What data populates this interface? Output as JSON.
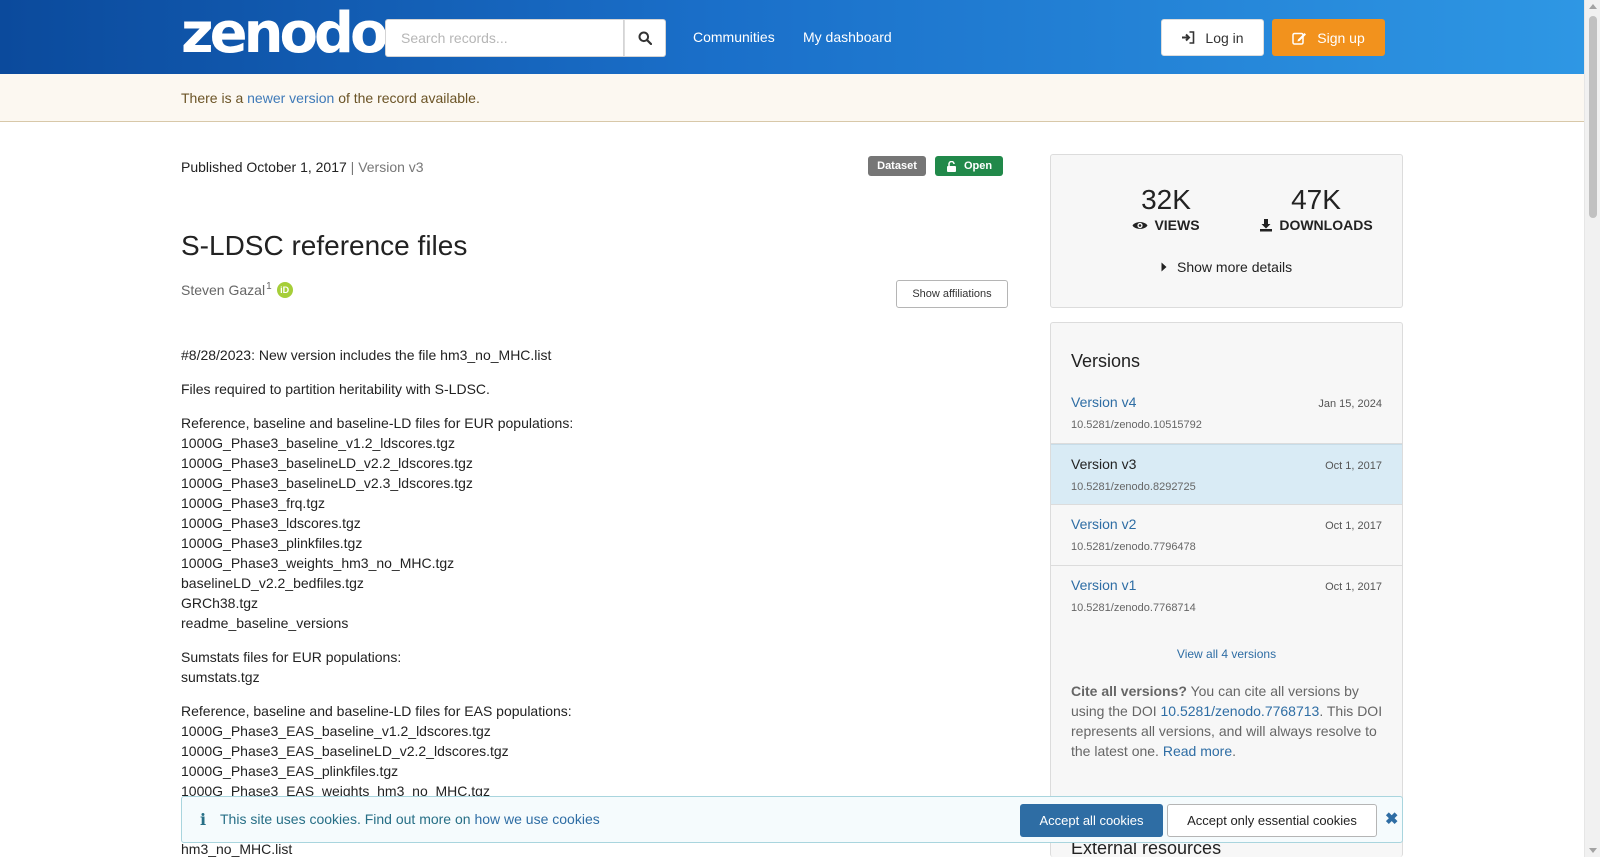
{
  "header": {
    "logo": "zenodo",
    "search_placeholder": "Search records...",
    "nav": [
      "Communities",
      "My dashboard"
    ],
    "login_label": "Log in",
    "signup_label": "Sign up"
  },
  "notice": {
    "prefix": "There is a",
    "link": "newer version",
    "suffix": "of the record available."
  },
  "record": {
    "published": "Published October 1, 2017",
    "version_sep": "|",
    "version": "Version v3",
    "badge_type": "Dataset",
    "badge_access": "Open",
    "title": "S-LDSC reference files",
    "author": "Steven Gazal",
    "author_affil_index": "1",
    "orcid_label": "iD",
    "show_affiliations": "Show affiliations",
    "description": [
      [
        "#8/28/2023: New version includes the file hm3_no_MHC.list"
      ],
      [
        "Files required to partition heritability with S-LDSC."
      ],
      [
        "Reference, baseline and baseline-LD files for EUR populations:",
        "1000G_Phase3_baseline_v1.2_ldscores.tgz",
        "1000G_Phase3_baselineLD_v2.2_ldscores.tgz",
        "1000G_Phase3_baselineLD_v2.3_ldscores.tgz",
        "1000G_Phase3_frq.tgz",
        "1000G_Phase3_ldscores.tgz",
        "1000G_Phase3_plinkfiles.tgz",
        "1000G_Phase3_weights_hm3_no_MHC.tgz",
        "baselineLD_v2.2_bedfiles.tgz",
        "GRCh38.tgz",
        "readme_baseline_versions"
      ],
      [
        "Sumstats files for EUR populations:",
        "sumstats.tgz"
      ],
      [
        "Reference, baseline and baseline-LD files for EAS populations:",
        "1000G_Phase3_EAS_baseline_v1.2_ldscores.tgz",
        "1000G_Phase3_EAS_baselineLD_v2.2_ldscores.tgz",
        "1000G_Phase3_EAS_plinkfiles.tgz",
        "1000G_Phase3_EAS_weights_hm3_no_MHC.tgz"
      ]
    ],
    "below_cookie_text": "hm3_no_MHC.list"
  },
  "stats": {
    "views_value": "32K",
    "views_label": "VIEWS",
    "downloads_value": "47K",
    "downloads_label": "DOWNLOADS",
    "more_details": "Show more details"
  },
  "versions": {
    "title": "Versions",
    "items": [
      {
        "name": "Version v4",
        "date": "Jan 15, 2024",
        "doi": "10.5281/zenodo.10515792",
        "selected": false
      },
      {
        "name": "Version v3",
        "date": "Oct 1, 2017",
        "doi": "10.5281/zenodo.8292725",
        "selected": true
      },
      {
        "name": "Version v2",
        "date": "Oct 1, 2017",
        "doi": "10.5281/zenodo.7796478",
        "selected": false
      },
      {
        "name": "Version v1",
        "date": "Oct 1, 2017",
        "doi": "10.5281/zenodo.7768714",
        "selected": false
      }
    ],
    "view_all": "View all 4 versions",
    "cite_bold": "Cite all versions?",
    "cite_pre": "You can cite all versions by using the DOI",
    "cite_doi": "10.5281/zenodo.7768713",
    "cite_post": ". This DOI represents all versions, and will always resolve to the latest one.",
    "read_more": "Read more",
    "external_resources": "External resources"
  },
  "cookie": {
    "text": "This site uses cookies. Find out more on",
    "link": "how we use cookies",
    "accept_all": "Accept all cookies",
    "accept_essential": "Accept only essential cookies"
  },
  "colors": {
    "header_start": "#0b4a9c",
    "header_end": "#2e97e4",
    "signup": "#f2921d",
    "open_badge": "#21894a",
    "link": "#2e6da4"
  }
}
